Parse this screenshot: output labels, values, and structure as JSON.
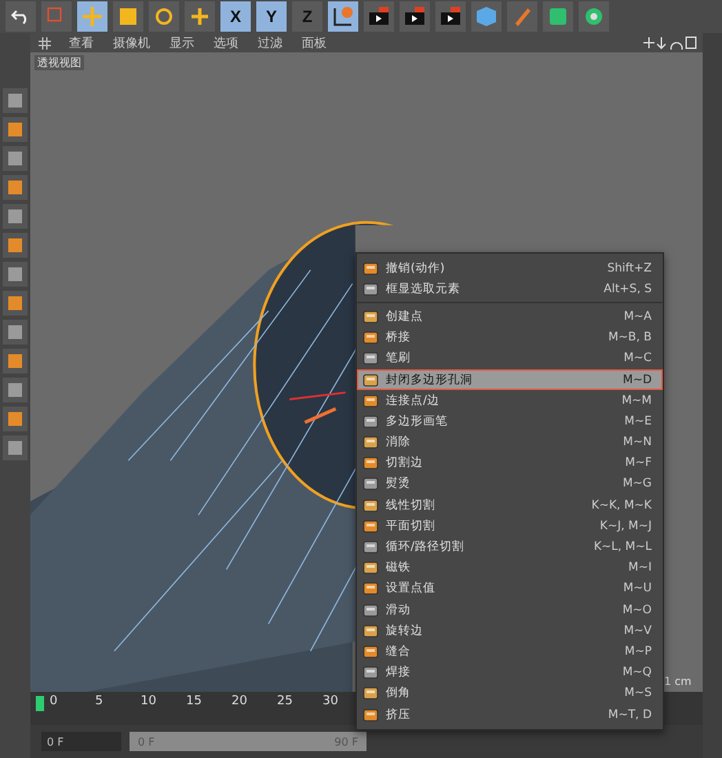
{
  "toolbar": {
    "axes": [
      "X",
      "Y",
      "Z"
    ]
  },
  "viewport": {
    "menu": [
      "查看",
      "摄像机",
      "显示",
      "选项",
      "过滤",
      "面板"
    ],
    "title": "透视视图"
  },
  "context_menu": {
    "items": [
      {
        "label": "撤销(动作)",
        "shortcut": "Shift+Z",
        "selected": false,
        "separator_after": false
      },
      {
        "label": "框显选取元素",
        "shortcut": "Alt+S, S",
        "selected": false,
        "separator_after": true
      },
      {
        "label": "创建点",
        "shortcut": "M~A",
        "selected": false,
        "separator_after": false
      },
      {
        "label": "桥接",
        "shortcut": "M~B, B",
        "selected": false,
        "separator_after": false
      },
      {
        "label": "笔刷",
        "shortcut": "M~C",
        "selected": false,
        "separator_after": false
      },
      {
        "label": "封闭多边形孔洞",
        "shortcut": "M~D",
        "selected": true,
        "separator_after": false
      },
      {
        "label": "连接点/边",
        "shortcut": "M~M",
        "selected": false,
        "separator_after": false
      },
      {
        "label": "多边形画笔",
        "shortcut": "M~E",
        "selected": false,
        "separator_after": false
      },
      {
        "label": "消除",
        "shortcut": "M~N",
        "selected": false,
        "separator_after": false
      },
      {
        "label": "切割边",
        "shortcut": "M~F",
        "selected": false,
        "separator_after": false
      },
      {
        "label": "熨烫",
        "shortcut": "M~G",
        "selected": false,
        "separator_after": false
      },
      {
        "label": "线性切割",
        "shortcut": "K~K, M~K",
        "selected": false,
        "separator_after": false
      },
      {
        "label": "平面切割",
        "shortcut": "K~J, M~J",
        "selected": false,
        "separator_after": false
      },
      {
        "label": "循环/路径切割",
        "shortcut": "K~L, M~L",
        "selected": false,
        "separator_after": false
      },
      {
        "label": "磁铁",
        "shortcut": "M~I",
        "selected": false,
        "separator_after": false
      },
      {
        "label": "设置点值",
        "shortcut": "M~U",
        "selected": false,
        "separator_after": false
      },
      {
        "label": "滑动",
        "shortcut": "M~O",
        "selected": false,
        "separator_after": false
      },
      {
        "label": "旋转边",
        "shortcut": "M~V",
        "selected": false,
        "separator_after": false
      },
      {
        "label": "缝合",
        "shortcut": "M~P",
        "selected": false,
        "separator_after": false
      },
      {
        "label": "焊接",
        "shortcut": "M~Q",
        "selected": false,
        "separator_after": false
      },
      {
        "label": "倒角",
        "shortcut": "M~S",
        "selected": false,
        "separator_after": false
      },
      {
        "label": "挤压",
        "shortcut": "M~T, D",
        "selected": false,
        "separator_after": false
      }
    ]
  },
  "scale_label": "1 cm",
  "timeline": {
    "ticks": [
      "0",
      "5",
      "10",
      "15",
      "20",
      "25",
      "30"
    ],
    "level": 0.0
  },
  "bottom": {
    "current_frame": "0 F",
    "range": {
      "start": "0 F",
      "end": "90 F",
      "level": 1
    }
  }
}
